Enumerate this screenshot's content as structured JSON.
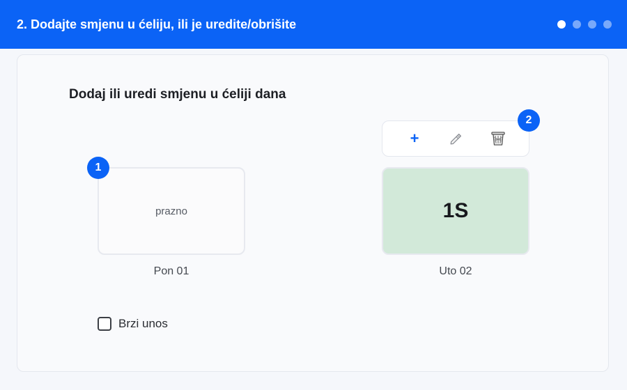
{
  "header": {
    "title": "2. Dodajte smjenu u ćeliju, ili je uredite/obrišite",
    "steps": 4,
    "active_step": 1
  },
  "card": {
    "title": "Dodaj ili uredi smjenu u ćeliji dana"
  },
  "cells": [
    {
      "content": "prazno",
      "day": "Pon 01",
      "badge": "1"
    },
    {
      "content": "1S",
      "day": "Uto 02",
      "badge": "2",
      "color": "#d2e9d9"
    }
  ],
  "toolbar": {
    "add_icon": "plus-icon",
    "edit_icon": "pencil-icon",
    "delete_icon": "trash-icon"
  },
  "quick_entry": {
    "label": "Brzi unos",
    "checked": false
  },
  "colors": {
    "accent": "#0b63f6",
    "shift_cell": "#d2e9d9"
  }
}
